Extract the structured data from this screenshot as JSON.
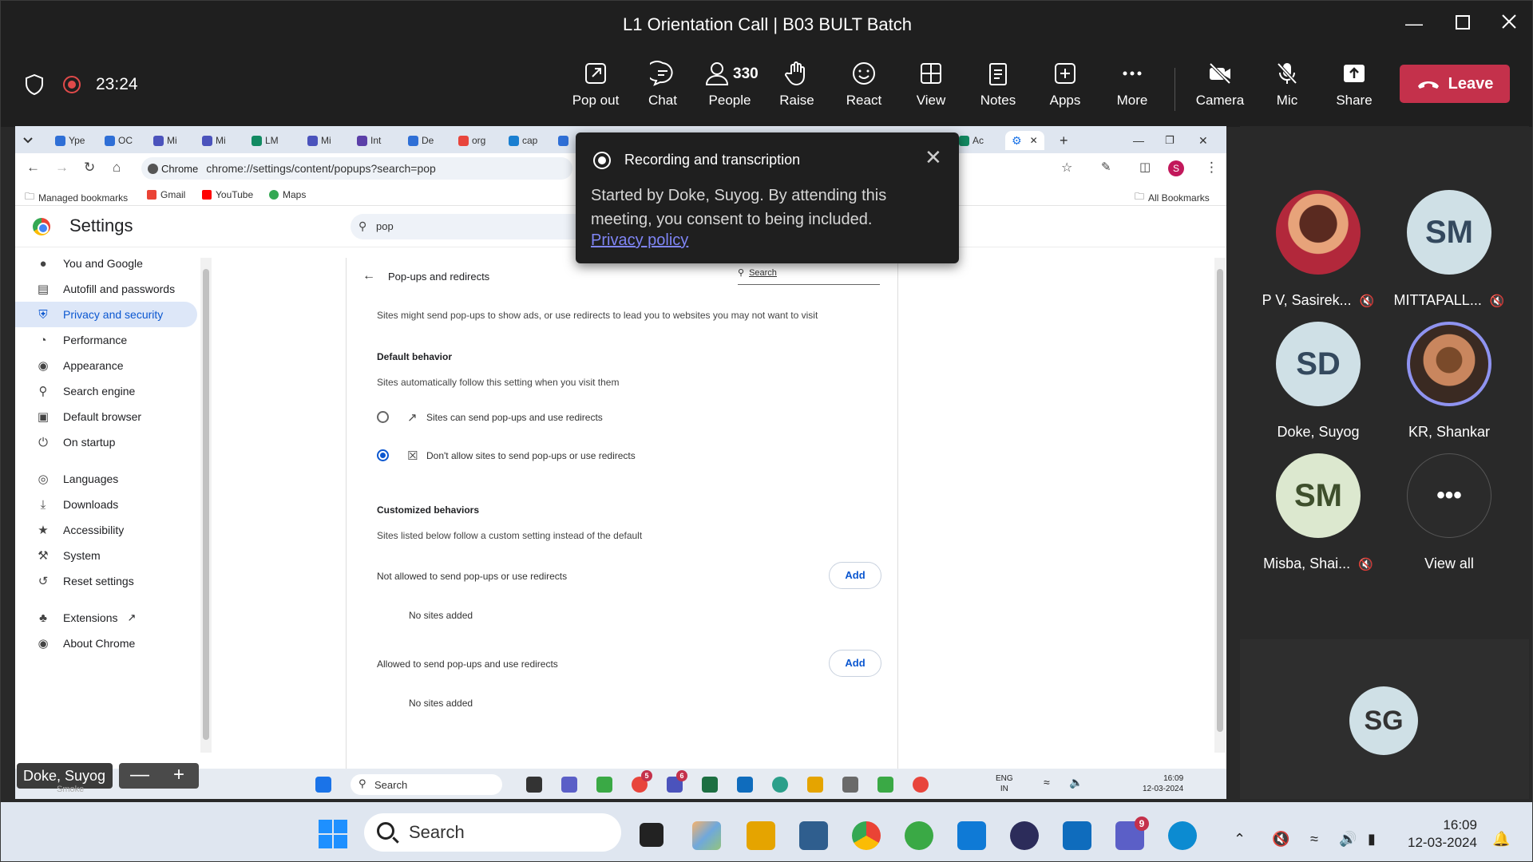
{
  "window": {
    "title": "L1 Orientation Call | B03 BULT Batch"
  },
  "meeting": {
    "timer": "23:24",
    "people_count": "330"
  },
  "toolbar": [
    {
      "key": "popout",
      "label": "Pop out"
    },
    {
      "key": "chat",
      "label": "Chat"
    },
    {
      "key": "people",
      "label": "People"
    },
    {
      "key": "raise",
      "label": "Raise"
    },
    {
      "key": "react",
      "label": "React"
    },
    {
      "key": "view",
      "label": "View"
    },
    {
      "key": "notes",
      "label": "Notes"
    },
    {
      "key": "apps",
      "label": "Apps"
    },
    {
      "key": "more",
      "label": "More"
    },
    {
      "key": "camera",
      "label": "Camera"
    },
    {
      "key": "mic",
      "label": "Mic"
    },
    {
      "key": "share",
      "label": "Share"
    }
  ],
  "leave_label": "Leave",
  "browser": {
    "tabs": [
      "Ype",
      "OC",
      "Mi",
      "Mi",
      "LM",
      "Mi",
      "Int",
      "De",
      "org",
      "cap",
      "Ac"
    ],
    "chrome_chip": "Chrome",
    "url": "chrome://settings/content/popups?search=pop",
    "profile_initial": "S",
    "bookmarks": [
      "Managed bookmarks",
      "Gmail",
      "YouTube",
      "Maps"
    ],
    "all_bookmarks": "All Bookmarks"
  },
  "settings": {
    "title": "Settings",
    "search_value": "pop",
    "nav": [
      "You and Google",
      "Autofill and passwords",
      "Privacy and security",
      "Performance",
      "Appearance",
      "Search engine",
      "Default browser",
      "On startup",
      "Languages",
      "Downloads",
      "Accessibility",
      "System",
      "Reset settings",
      "Extensions",
      "About Chrome"
    ],
    "page_title": "Pop-ups and redirects",
    "search_placeholder": "Search",
    "description": "Sites might send pop-ups to show ads, or use redirects to lead you to websites you may not want to visit",
    "default_behavior": "Default behavior",
    "default_sub": "Sites automatically follow this setting when you visit them",
    "option_allow": "Sites can send pop-ups and use redirects",
    "option_block": "Don't allow sites to send pop-ups or use redirects",
    "customized": "Customized behaviors",
    "customized_sub": "Sites listed below follow a custom setting instead of the default",
    "not_allowed": "Not allowed to send pop-ups or use redirects",
    "allowed": "Allowed to send pop-ups and use redirects",
    "no_sites": "No sites added",
    "add_label": "Add"
  },
  "inner_taskbar": {
    "search": "Search",
    "lang": "ENG",
    "region": "IN",
    "time": "16:09",
    "date": "12-03-2024"
  },
  "popup": {
    "title": "Recording and transcription",
    "body": "Started by Doke, Suyog. By attending this meeting, you consent to being included.",
    "link": "Privacy policy"
  },
  "participants": [
    {
      "name": "P V, Sasirek...",
      "initials": "",
      "muted": true
    },
    {
      "name": "MITTAPALL...",
      "initials": "SM",
      "muted": true
    },
    {
      "name": "Doke, Suyog",
      "initials": "SD",
      "muted": false
    },
    {
      "name": "KR, Shankar",
      "initials": "",
      "muted": false
    },
    {
      "name": "Misba, Shai...",
      "initials": "SM",
      "muted": true
    },
    {
      "name": "View all",
      "initials": "",
      "muted": false
    }
  ],
  "spotlight_initials": "SG",
  "self_label": "Doke, Suyog",
  "self_sub": "Smoke",
  "taskbar": {
    "search": "Search",
    "time": "16:09",
    "date": "12-03-2024",
    "teams_badge": "9",
    "inner_badge1": "5",
    "inner_badge2": "6"
  }
}
